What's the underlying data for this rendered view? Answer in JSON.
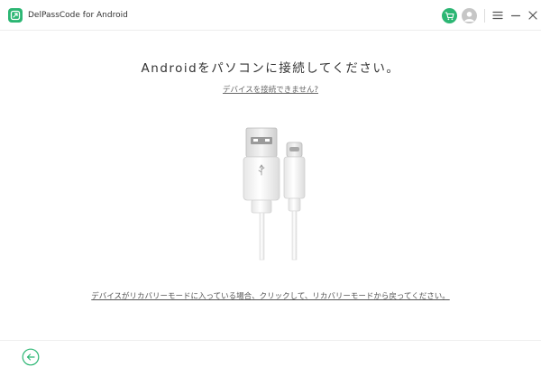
{
  "app": {
    "title": "DelPassCode for Android",
    "brand_color": "#2bb673"
  },
  "titlebar": {
    "icons": [
      "cart-icon",
      "user-icon",
      "menu-icon",
      "minimize-icon",
      "close-icon"
    ]
  },
  "main": {
    "heading": "Androidをパソコンに接続してください。",
    "help_link": "デバイスを接続できません?",
    "illustration": "usb-cable-illustration",
    "recovery_link": "デバイスがリカバリーモードに入っている場合、クリックして、リカバリーモードから戻ってください。"
  },
  "footer": {
    "back_icon": "back-arrow-icon"
  }
}
